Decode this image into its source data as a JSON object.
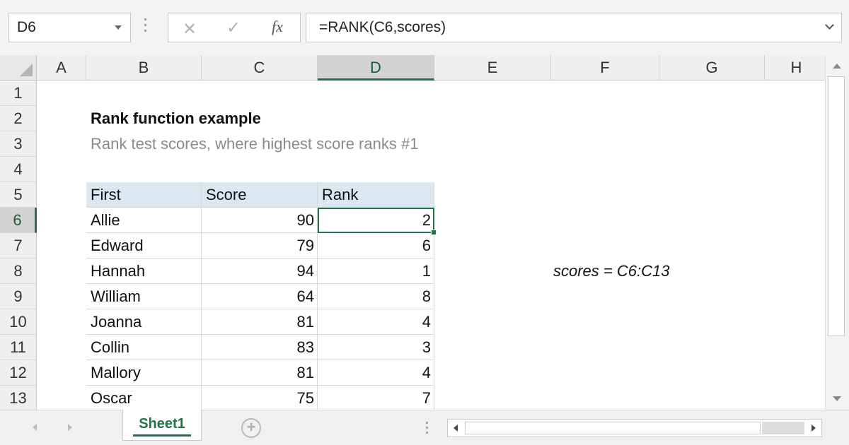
{
  "formula_bar": {
    "name_box": "D6",
    "cancel_icon": "✕",
    "enter_icon": "✓",
    "fx_label": "fx",
    "formula": "=RANK(C6,scores)"
  },
  "columns": [
    "A",
    "B",
    "C",
    "D",
    "E",
    "F",
    "G",
    "H"
  ],
  "selected_column": "D",
  "rows": [
    "1",
    "2",
    "3",
    "4",
    "5",
    "6",
    "7",
    "8",
    "9",
    "10",
    "11",
    "12",
    "13"
  ],
  "selected_row": "6",
  "sheet": {
    "title": "Rank function example",
    "subtitle": "Rank test scores, where highest score ranks #1",
    "table_headers": [
      "First",
      "Score",
      "Rank"
    ],
    "table_rows": [
      {
        "first": "Allie",
        "score": "90",
        "rank": "2"
      },
      {
        "first": "Edward",
        "score": "79",
        "rank": "6"
      },
      {
        "first": "Hannah",
        "score": "94",
        "rank": "1"
      },
      {
        "first": "William",
        "score": "64",
        "rank": "8"
      },
      {
        "first": "Joanna",
        "score": "81",
        "rank": "4"
      },
      {
        "first": "Collin",
        "score": "83",
        "rank": "3"
      },
      {
        "first": "Mallory",
        "score": "81",
        "rank": "4"
      },
      {
        "first": "Oscar",
        "score": "75",
        "rank": "7"
      }
    ],
    "named_range_note": "scores = C6:C13"
  },
  "tabs": {
    "active_sheet": "Sheet1",
    "add_sheet_icon": "+"
  },
  "colors": {
    "accent": "#217346",
    "header_fill": "#dde7f2",
    "subtitle": "#8a8a8a"
  }
}
